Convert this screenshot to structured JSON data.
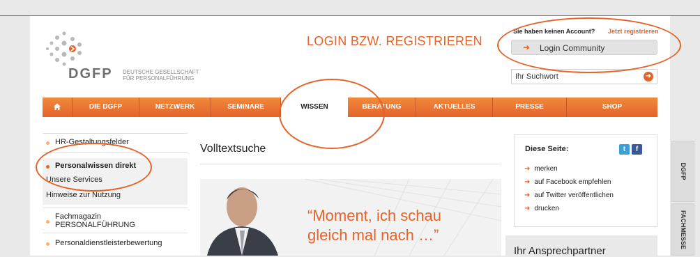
{
  "annotation": {
    "title": "LOGIN BZW. REGISTRIEREN"
  },
  "logo": {
    "word": "DGFP",
    "sub_line1": "DEUTSCHE GESELLSCHAFT",
    "sub_line2": "FÜR PERSONALFÜHRUNG"
  },
  "account": {
    "question": "Sie haben keinen Account?",
    "register_link": "Jetzt registrieren",
    "login_button": "Login Community"
  },
  "search": {
    "placeholder": "Ihr Suchwort"
  },
  "nav": {
    "home_icon": "home-icon",
    "items": [
      "DIE DGFP",
      "NETZWERK",
      "SEMINARE",
      "WISSEN",
      "BERATUNG",
      "AKTUELLES",
      "PRESSE",
      "SHOP"
    ],
    "active": "WISSEN"
  },
  "sidebar": {
    "items": [
      "HR-Gestaltungsfelder",
      "Personalwissen direkt",
      "Unsere Services",
      "Hinweise zur Nutzung",
      "Fachmagazin",
      "PERSONALFÜHRUNG",
      "Personaldienstleisterbewertung"
    ]
  },
  "main": {
    "heading": "Volltextsuche",
    "quote_line1": "“Moment, ich schau",
    "quote_line2": "gleich mal nach …”"
  },
  "page_panel": {
    "title": "Diese Seite:",
    "links": [
      "merken",
      "auf Facebook empfehlen",
      "auf Twitter veröffentlichen",
      "drucken"
    ],
    "twitter": "t",
    "facebook": "f"
  },
  "contact": {
    "title": "Ihr Ansprechpartner"
  },
  "side_tabs": [
    "DGFP",
    "FACHMESSE"
  ],
  "colors": {
    "accent": "#e4632a",
    "nav_light": "#f08a3c"
  }
}
